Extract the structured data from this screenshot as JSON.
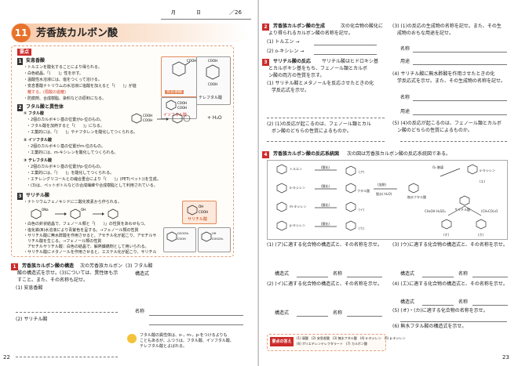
{
  "header": {
    "month_label": "月",
    "day_label": "日",
    "score": "／26"
  },
  "chapter": {
    "number": "11",
    "title": "芳香族カルボン酸"
  },
  "summary": {
    "badge": "要点",
    "s1": {
      "num": "1",
      "title": "安息香酸",
      "lines": [
        "・トルエンを酸化することにより得られる。",
        "・白色結晶。「(　　)」性を示す。",
        "・温酸性水溶液には、塩をつくって溶ける。",
        "・安息香酸ナトリウムの水溶液に塩酸を加えると「(　　)」が遊",
        "　離する。(弱酸の遊離)",
        "・防腐剤、合成樹脂、染料などの原料になる。"
      ],
      "mol_labels": [
        "安息香酸",
        "テレフタル酸",
        "イソフタル酸"
      ]
    },
    "s2": {
      "num": "2",
      "title": "フタル酸と異性体",
      "sub1": "① フタル酸",
      "sub1_lines": [
        "・2個のカルボキシ基の位置がo-位のもの。",
        "・フタル酸を加熱すると「(　　)」になる。",
        "・工業的には、「(　　)」やナフタレンを酸化してつくられる。"
      ],
      "sub2": "② イソフタル酸",
      "sub2_lines": [
        "・2個のカルボキシ基の位置がm-位のもの。",
        "・工業的には、m-キシレンを酸化してつくられる。"
      ],
      "sub3": "③ テレフタル酸",
      "sub3_lines": [
        "・2個のカルボキシ基の位置がp-位のもの。",
        "・工業的には、「(　　)」を酸化してつくられる。",
        "・エチレングリコールとの縮合重合により「(　　)」(PET(ペット))を生成。",
        "・(3)は、ペットボトルなどの合成繊維や合成樹脂として利用されている。"
      ],
      "eq": "+ H₂O"
    },
    "s3": {
      "num": "3",
      "title": "サリチル酸",
      "lines": [
        "・ナトリウムフェノキシドに二酸化炭素から作られる。",
        "・白色の針状結晶で、フェノール類と「(　　)」の性質をあわせもつ。",
        "・塩化鉄(Ⅲ)水溶液により青紫色を呈する。→フェノール類の性質",
        "・サリチル酸に無水酢酸を作用させると、アセチル化が起こり、アセチルサ",
        "　リチル酸を生じる。→フェノール類の性質",
        "　アセチルサリチル酸：白色の結晶で、解熱鎮痛剤として用いられる。",
        "・サリチル酸にメタノールを作用させると、エステル化が起こり、サリチル",
        "　酸メチルを生じる。→カルボン酸の性質",
        "　サリチル酸メチル：無色の液体で、消炎鎮痛剤として用いられる。"
      ],
      "mol_labels": [
        "ナトリウムフェノキシド",
        "サリチル酸ナトリウム",
        "サリチル酸",
        "アセチルサリチル酸",
        "サリチル酸メチル"
      ]
    }
  },
  "q1": {
    "num": "1",
    "title": "芳香族カルボン酸の構造",
    "text1": "次の芳香族カルボン",
    "text2": "酸の構造式を示せ。(3)については、異性体も示",
    "text3": "すこと。また、その名称も記せ。",
    "items": [
      "(1) 安息香酸",
      "(2) サリチル酸",
      "(3) フタル酸"
    ],
    "sub": "構造式",
    "name_label": "名称",
    "hint": "フタル酸の異性体は、o-，m-，p-をつけるよりも\nこともあるが、ふつうは、フタル酸、イソフタル酸、\nテレフタル酸とよばれる。"
  },
  "q2": {
    "num": "2",
    "title": "芳香族カルボン酸の生成",
    "text": "次の化合物の酸化に",
    "text2": "より得られるカルボン酸の名称を記せ。",
    "items": [
      "(1) トルエン →",
      "(2) o-キシレン →"
    ]
  },
  "q3": {
    "num": "3",
    "title": "サリチル酸の反応",
    "text": "サリチル酸はヒドロキシ基",
    "text2": "とカルボキシ基をもち、フェノール類とカルボ",
    "text3": "ン酸の両方の性質を示す。",
    "items": [
      "(1) サリチル酸とメタノールを反応させたときの化",
      "　学反応式を示せ。",
      "(2) (1)の反応が起こるのは、フェノール類とカル",
      "　ボン酸のどちらの性質によるものか。",
      "(3) (1)の反応の生成物の名称を記せ。また、その生",
      "　成物のおもな用途を記せ。",
      "(4) サリチル酸に無水酢酸を作用させたときの化",
      "　学反応式を示せ。また、その生成物の名称を記せ。",
      "(5) (4)の反応が起こるのは、フェノール類とカルボ",
      "　ン酸のどちらの性質によるものか。"
    ],
    "labels": [
      "名称",
      "用途",
      "名称",
      "用途"
    ]
  },
  "q4": {
    "num": "4",
    "title": "芳香族カルボン酸の反応系統図",
    "text": "次の図は芳香族カルボン酸の反応系統図である。",
    "diagram": [
      "トルエン",
      "o-キシレン",
      "m-キシレン",
      "p-キシレン",
      "(酸化)",
      "(酸化)",
      "(酸化)",
      "(酸化)",
      "フタル酸",
      "無水フタル酸",
      "(加熱)",
      "脱水(-H₂O)",
      "O₂ 触媒",
      "サリチル酸",
      "CH₃OH H₂SO₄",
      "(CH₃CO)₂O",
      "(ア)",
      "(イ)",
      "(ウ)",
      "(エ)",
      "(オ)",
      "(カ)",
      "o-キシレン"
    ],
    "items": [
      "(1) (ア)に適する化合物の構造式と、その名称を示せ。",
      "(2) (イ)に適する化合物の構造式と、その名称を示せ。",
      "(3) (ウ)に適する化合物の構造式と、その名称を示せ。",
      "(4) (エ)に適する化合物の構造式と、その名称を示せ。",
      "(5) (オ)・(カ)に適する化合物の名称を示せ。",
      "(6) 無水フタル酸の構造式を示せ。"
    ],
    "sub": [
      "構造式",
      "名称"
    ]
  },
  "answers": {
    "badge": "要点の答え",
    "line1": "(1) 弱酸　(2) 安息香酸　(3) 無水フタル酸　(4) o-キシレン　(5) p-キシレン",
    "line2": "(6) ポリエチレンテレフタラート　(7) カルボン酸"
  },
  "page_numbers": {
    "left": "22",
    "right": "23"
  }
}
